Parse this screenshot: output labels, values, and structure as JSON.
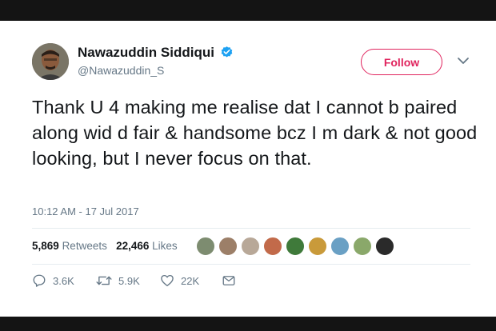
{
  "user": {
    "name": "Nawazuddin Siddiqui",
    "handle": "@Nawazuddin_S",
    "verified": true
  },
  "follow_label": "Follow",
  "tweet": {
    "text": "Thank U 4 making me realise dat I cannot b paired along wid d fair & handsome bcz I m dark & not good looking, but I never focus on that.",
    "timestamp": "10:12 AM - 17 Jul 2017"
  },
  "stats": {
    "retweets_count": "5,869",
    "retweets_label": "Retweets",
    "likes_count": "22,466",
    "likes_label": "Likes"
  },
  "actions": {
    "reply_count": "3.6K",
    "retweet_count": "5.9K",
    "like_count": "22K"
  },
  "colors": {
    "accent": "#e0245e",
    "verified_blue": "#1da1f2",
    "secondary_text": "#657786",
    "primary_text": "#14171a"
  },
  "icons": [
    "verified-badge-icon",
    "chevron-down-icon",
    "reply-icon",
    "retweet-icon",
    "like-icon",
    "message-icon"
  ]
}
